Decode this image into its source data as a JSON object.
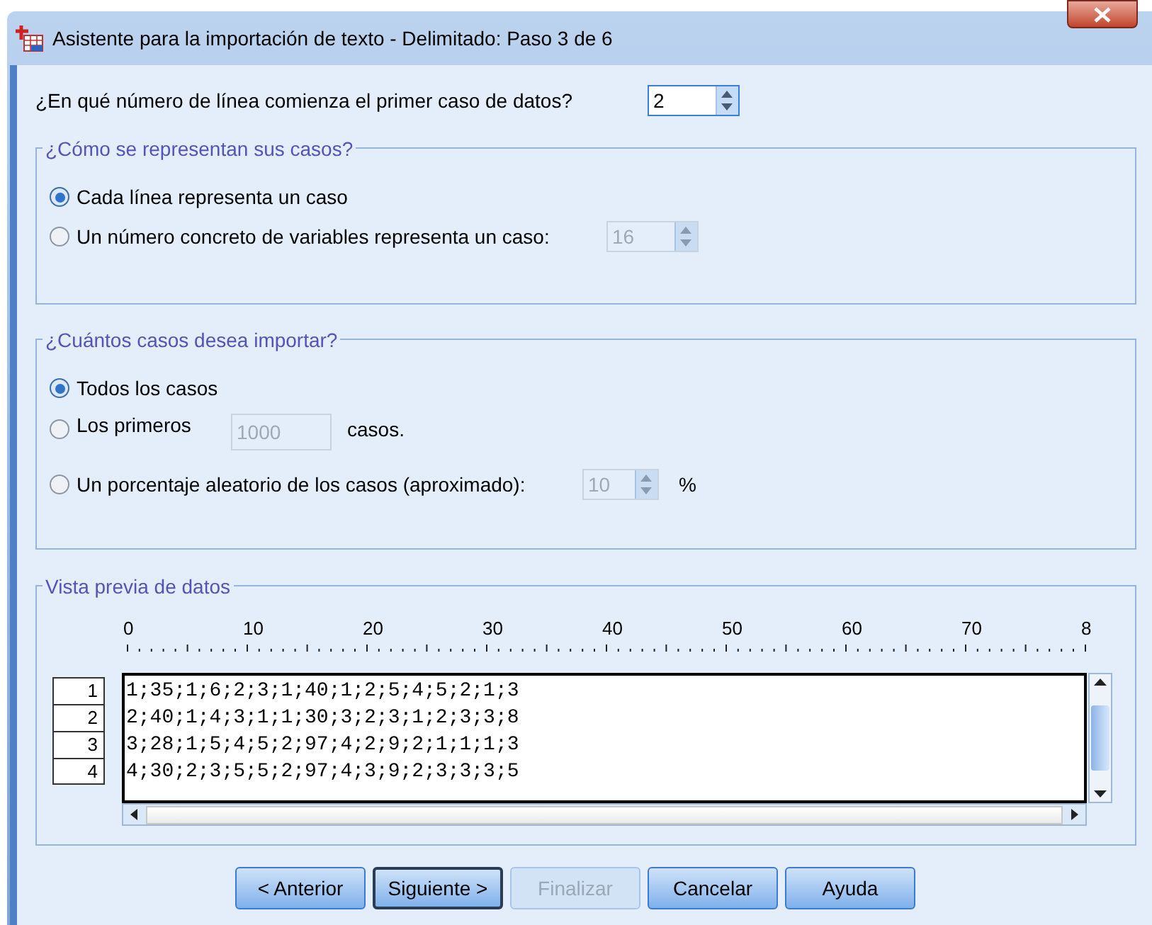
{
  "window": {
    "title": "Asistente para la importación de texto - Delimitado: Paso 3 de 6"
  },
  "start_line": {
    "label": "¿En qué número de línea comienza el primer caso de datos?",
    "value": "2"
  },
  "representation": {
    "legend": "¿Cómo se representan sus casos?",
    "options": [
      {
        "kind": "plain",
        "label": "Cada línea representa un caso",
        "selected": true
      },
      {
        "kind": "spinner",
        "label": "Un número concreto de variables representa un caso:",
        "selected": false,
        "field": {
          "value": "16",
          "disabled": true
        }
      }
    ]
  },
  "import": {
    "legend": "¿Cuántos casos desea importar?",
    "options": [
      {
        "kind": "plain",
        "label": "Todos los casos",
        "selected": true
      },
      {
        "kind": "count",
        "label": "Los primeros",
        "selected": false,
        "field": {
          "value": "1000",
          "disabled": true
        },
        "suffix": "casos."
      },
      {
        "kind": "spinner",
        "label": "Un porcentaje aleatorio de los casos (aproximado):",
        "selected": false,
        "field": {
          "value": "10",
          "disabled": true
        },
        "suffix": "%"
      }
    ]
  },
  "preview": {
    "legend": "Vista previa de datos",
    "ruler": [
      "0",
      "10",
      "20",
      "30",
      "40",
      "50",
      "60",
      "70",
      "8"
    ],
    "row_numbers": [
      "1",
      "2",
      "3",
      "4"
    ],
    "lines": [
      "1;35;1;6;2;3;1;40;1;2;5;4;5;2;1;3",
      "2;40;1;4;3;1;1;30;3;2;3;1;2;3;3;8",
      "3;28;1;5;4;5;2;97;4;2;9;2;1;1;1;3",
      "4;30;2;3;5;5;2;97;4;3;9;2;3;3;3;5"
    ]
  },
  "buttons": [
    {
      "label": "< Anterior",
      "disabled": false,
      "focused": false
    },
    {
      "label": "Siguiente >",
      "disabled": false,
      "focused": true
    },
    {
      "label": "Finalizar",
      "disabled": true,
      "focused": false
    },
    {
      "label": "Cancelar",
      "disabled": false,
      "focused": false
    },
    {
      "label": "Ayuda",
      "disabled": false,
      "focused": false
    }
  ]
}
